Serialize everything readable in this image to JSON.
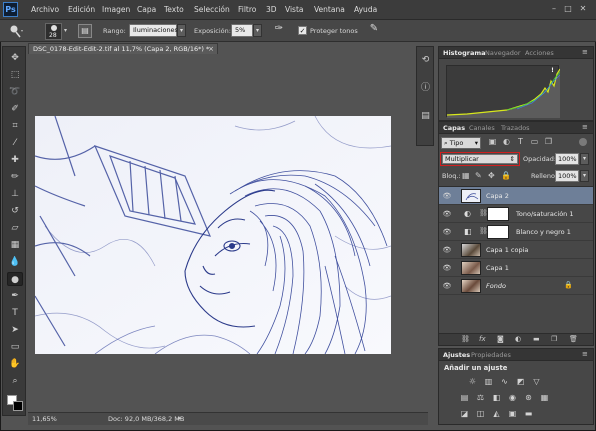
{
  "app": {
    "logo": "Ps"
  },
  "menu": [
    "Archivo",
    "Edición",
    "Imagen",
    "Capa",
    "Texto",
    "Selección",
    "Filtro",
    "3D",
    "Vista",
    "Ventana",
    "Ayuda"
  ],
  "window_controls": {
    "minimize": "–",
    "maximize": "□",
    "close": "✕"
  },
  "options": {
    "brush_size": "28",
    "range_label": "Rango:",
    "range_value": "Iluminaciones",
    "exposure_label": "Exposición:",
    "exposure_value": "5%",
    "protect_label": "Proteger tonos",
    "protect_checked": true
  },
  "document": {
    "tab_title": "DSC_0178-Edit-Edit-2.tif al 11,7% (Capa 2, RGB/16*) *",
    "tab_close": "×",
    "zoom": "11,65%",
    "doc_info": "Doc: 92,0 MB/368,2 MB"
  },
  "histogram_panel": {
    "tabs": [
      "Histograma",
      "Navegador",
      "Acciones"
    ],
    "warning": "!"
  },
  "layers_panel": {
    "tabs": [
      "Capas",
      "Canales",
      "Trazados"
    ],
    "filter_kind": "Tipo",
    "blend_mode": "Multiplicar",
    "opacity_label": "Opacidad:",
    "opacity_value": "100%",
    "lock_label": "Bloq.:",
    "fill_label": "Relleno:",
    "fill_value": "100%",
    "layers": [
      {
        "name": "Capa 2",
        "selected": true,
        "italic": false
      },
      {
        "name": "Tono/saturación 1",
        "selected": false,
        "italic": false
      },
      {
        "name": "Blanco y negro 1",
        "selected": false,
        "italic": false
      },
      {
        "name": "Capa 1 copia",
        "selected": false,
        "italic": false
      },
      {
        "name": "Capa 1",
        "selected": false,
        "italic": false
      },
      {
        "name": "Fondo",
        "selected": false,
        "italic": true
      }
    ],
    "footer_icons": [
      "link-icon",
      "fx-icon",
      "mask-icon",
      "adjustment-icon",
      "folder-icon",
      "new-layer-icon",
      "trash-icon"
    ]
  },
  "adjustments_panel": {
    "tabs": [
      "Ajustes",
      "Propiedades"
    ],
    "heading": "Añadir un ajuste"
  },
  "colors": {
    "selection_highlight": "#6e7f98",
    "blend_mode_outline": "#d02020",
    "histogram_line": "#d8e81c"
  }
}
